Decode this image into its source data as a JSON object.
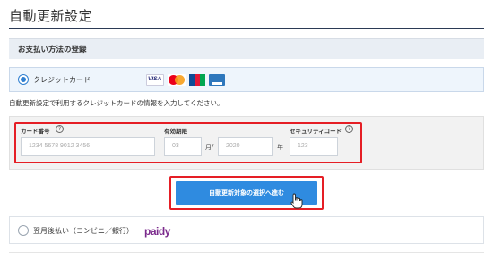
{
  "page": {
    "title": "自動更新設定",
    "section_header": "お支払い方法の登録"
  },
  "payment_options": {
    "credit_card": {
      "label": "クレジットカード",
      "selected": true,
      "brands": [
        "visa-icon",
        "mastercard-icon",
        "jcb-icon",
        "amex-icon"
      ],
      "visa_text": "VISA"
    },
    "paidy": {
      "label": "翌月後払い（コンビニ／銀行）",
      "selected": false,
      "logo_text": "paidy"
    }
  },
  "instruction": "自動更新設定で利用するクレジットカードの情報を入力してください。",
  "card_form": {
    "card_number": {
      "label": "カード番号",
      "placeholder": "1234 5678 9012 3456"
    },
    "expiry": {
      "label": "有効期限",
      "month_placeholder": "03",
      "month_unit": "月",
      "separator": "/",
      "year_placeholder": "2020",
      "year_unit": "年"
    },
    "security_code": {
      "label": "セキュリティコード",
      "placeholder": "123"
    },
    "help_symbol": "?"
  },
  "actions": {
    "proceed_label": "自動更新対象の選択へ進む"
  },
  "colors": {
    "accent": "#2f8be0",
    "highlight": "#e51e25",
    "title_rule": "#2b3a55",
    "section_bg": "#e9eef4"
  }
}
